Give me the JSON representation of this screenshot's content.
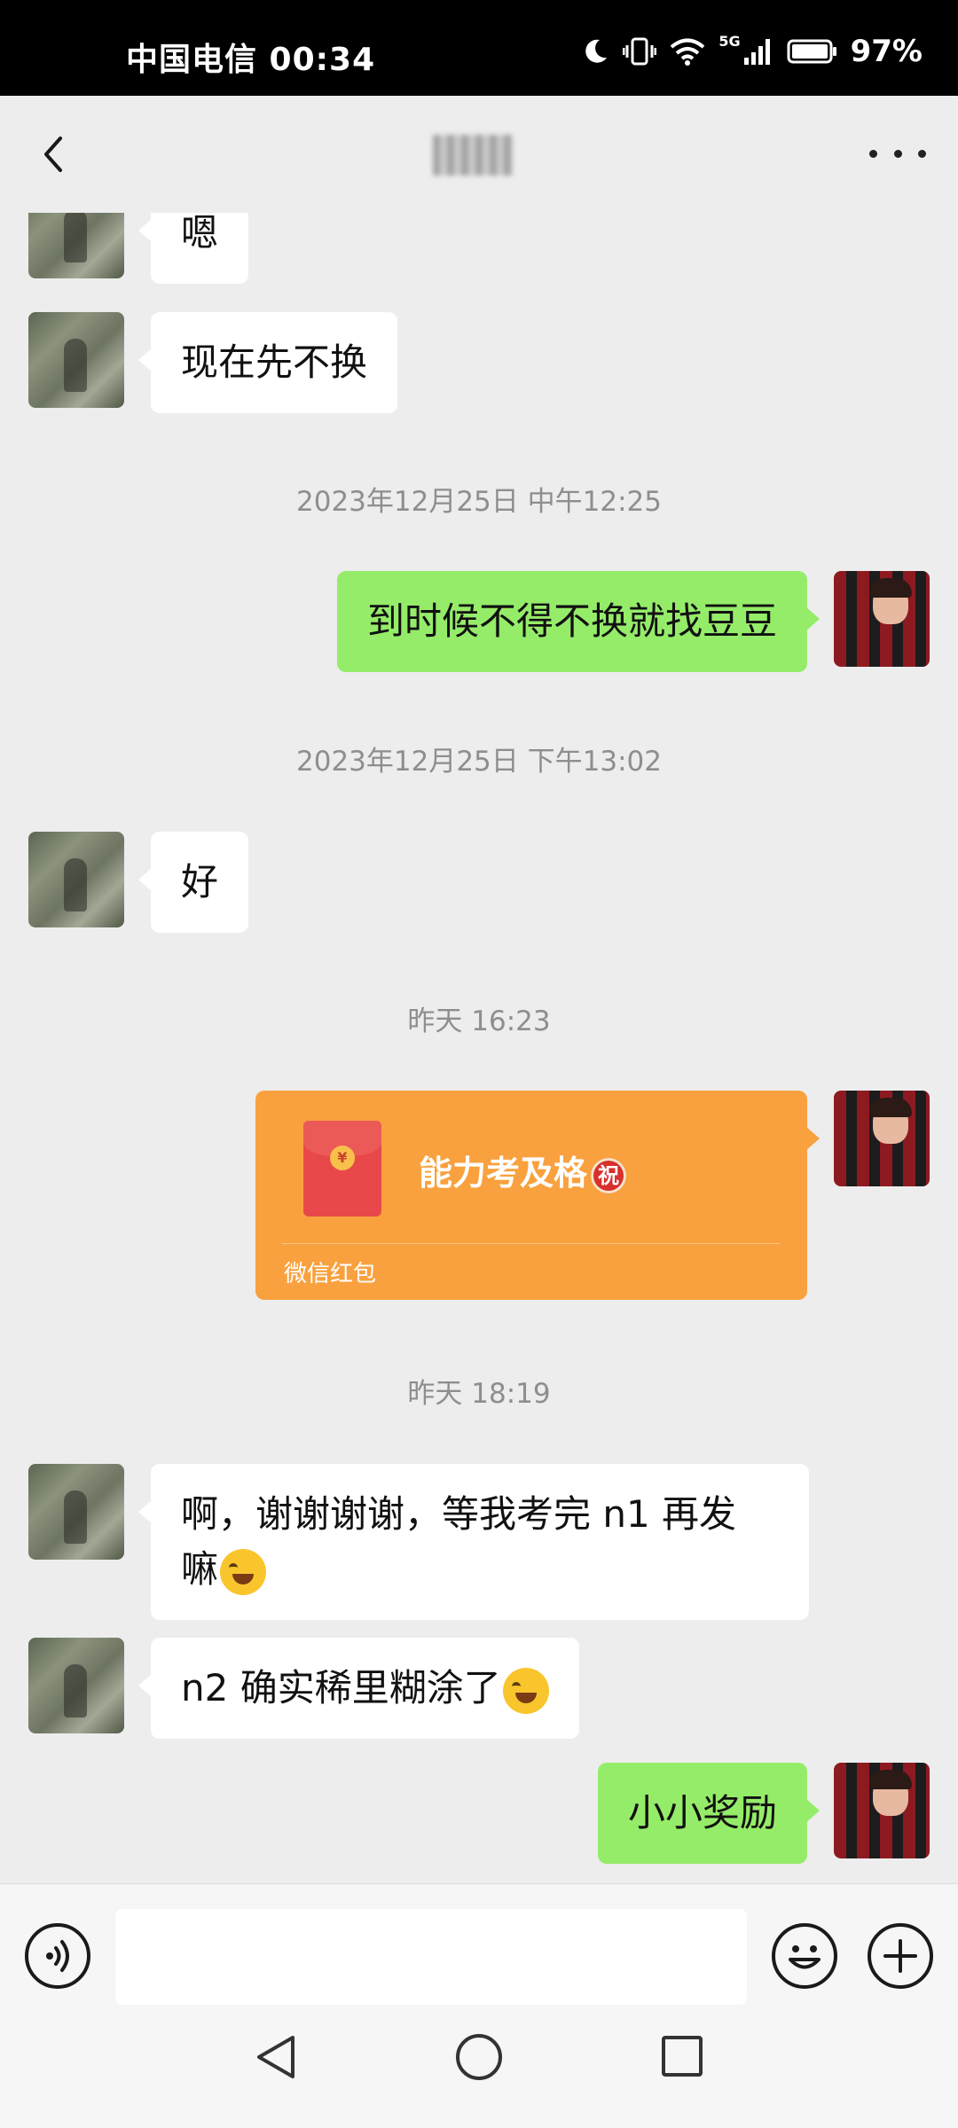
{
  "status_bar": {
    "carrier_time": "中国电信 00:34",
    "network": "5G",
    "battery": "97%"
  },
  "header": {
    "title": "",
    "back_icon": "chevron-left-icon",
    "more_icon": "more-dots-icon"
  },
  "messages": [
    {
      "from": "friend",
      "text": "嗯"
    },
    {
      "from": "friend",
      "text": "现在先不换"
    },
    {
      "type": "timestamp",
      "text": "2023年12月25日 中午12:25"
    },
    {
      "from": "me",
      "text": "到时候不得不换就找豆豆"
    },
    {
      "type": "timestamp",
      "text": "2023年12月25日 下午13:02"
    },
    {
      "from": "friend",
      "text": "好"
    },
    {
      "type": "timestamp",
      "text": "昨天 16:23"
    },
    {
      "from": "me",
      "type": "red_packet",
      "title": "能力考及格",
      "badge": "祝",
      "label": "微信红包"
    },
    {
      "type": "timestamp",
      "text": "昨天 18:19"
    },
    {
      "from": "friend",
      "text_line1": "啊，谢谢谢谢，等我考完 n1 再发",
      "text_line2": "嘛",
      "emoji": "crying-face-icon"
    },
    {
      "from": "friend",
      "text": "n2 确实稀里糊涂了",
      "emoji": "laughing-face-icon"
    },
    {
      "from": "me",
      "text": "小小奖励"
    }
  ],
  "input_bar": {
    "placeholder": "",
    "voice_icon": "voice-icon",
    "emoji_icon": "emoji-icon",
    "plus_icon": "plus-icon"
  },
  "nav_bar": {
    "back_icon": "nav-back-icon",
    "home_icon": "nav-home-icon",
    "recent_icon": "nav-recent-icon"
  }
}
